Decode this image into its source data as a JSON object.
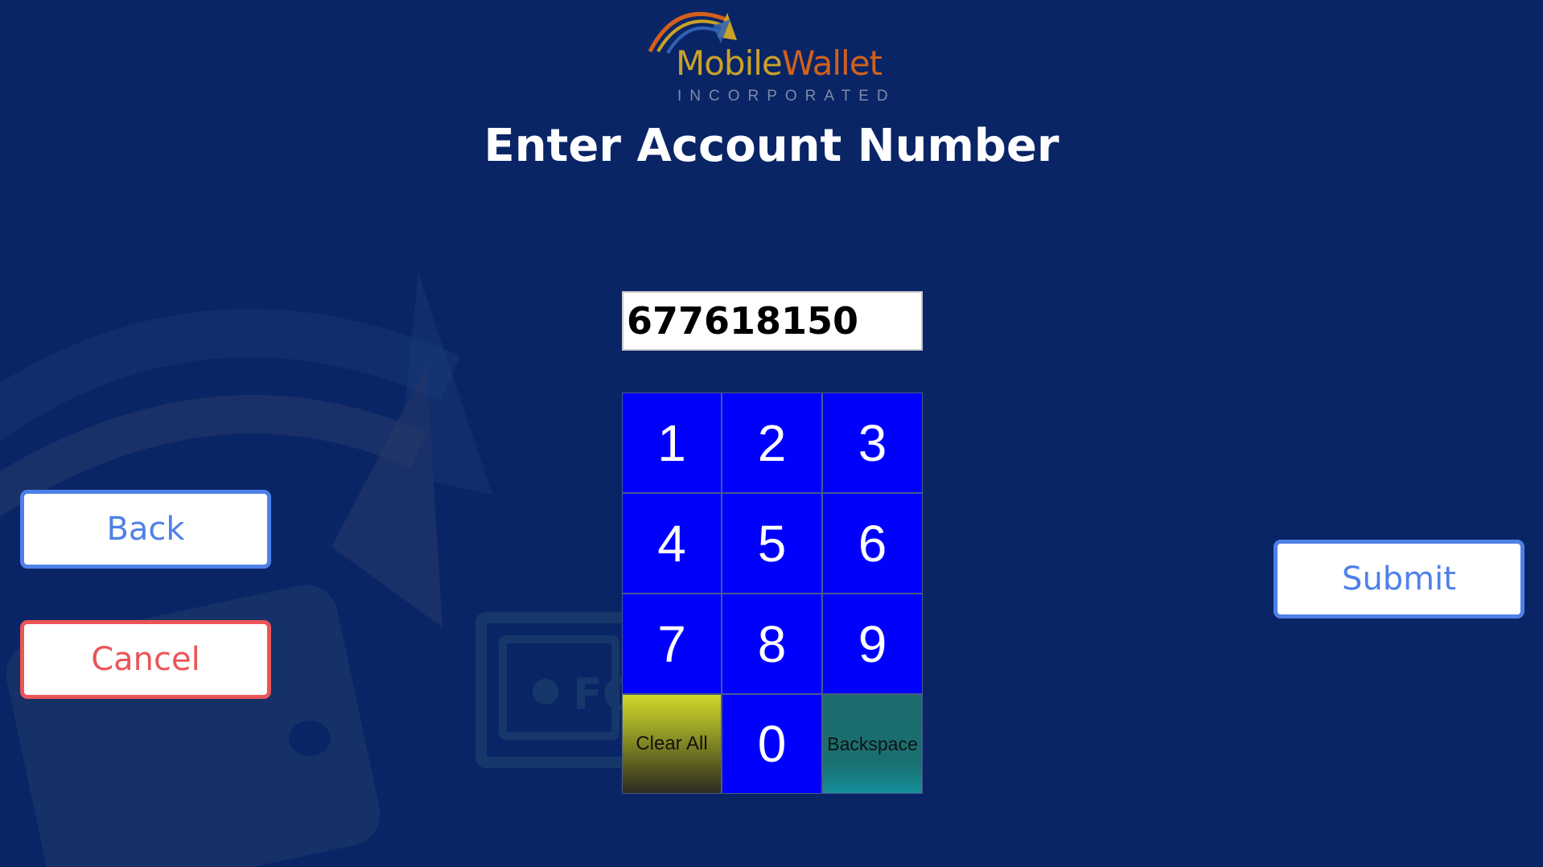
{
  "logo": {
    "wordmark_part1": "Mobile",
    "wordmark_part2": "Wallet",
    "subtitle": "INCORPORATED"
  },
  "header": {
    "title": "Enter Account Number"
  },
  "account": {
    "value": "677618150"
  },
  "keypad": {
    "keys": [
      "1",
      "2",
      "3",
      "4",
      "5",
      "6",
      "7",
      "8",
      "9",
      "Clear All",
      "0",
      "Backspace"
    ]
  },
  "buttons": {
    "back": "Back",
    "cancel": "Cancel",
    "submit": "Submit"
  },
  "colors": {
    "background": "#0a2566",
    "key": "#0000fd",
    "primary": "#4f80e8",
    "danger": "#ea5556",
    "logo_gold": "#c9a227",
    "logo_orange": "#d2601c"
  },
  "icons": {
    "background_art": "wallet-arrow-icon",
    "logo_mark": "logo-arc-icon"
  }
}
